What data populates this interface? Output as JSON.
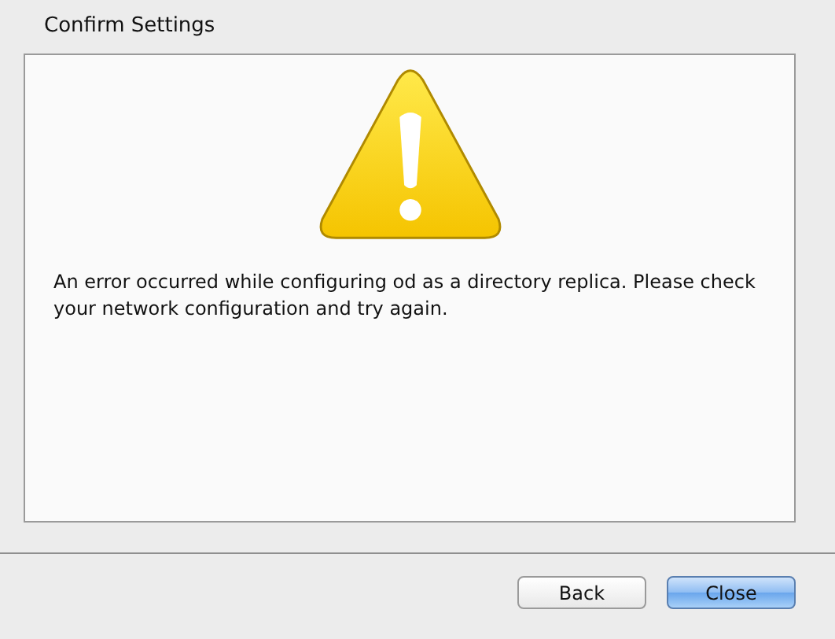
{
  "window": {
    "title": "Confirm Settings"
  },
  "message": "An error occurred while configuring od as a directory replica. Please check your network configuration and try again.",
  "buttons": [
    {
      "label": "Back",
      "default": false
    },
    {
      "label": "Close",
      "default": true
    }
  ]
}
